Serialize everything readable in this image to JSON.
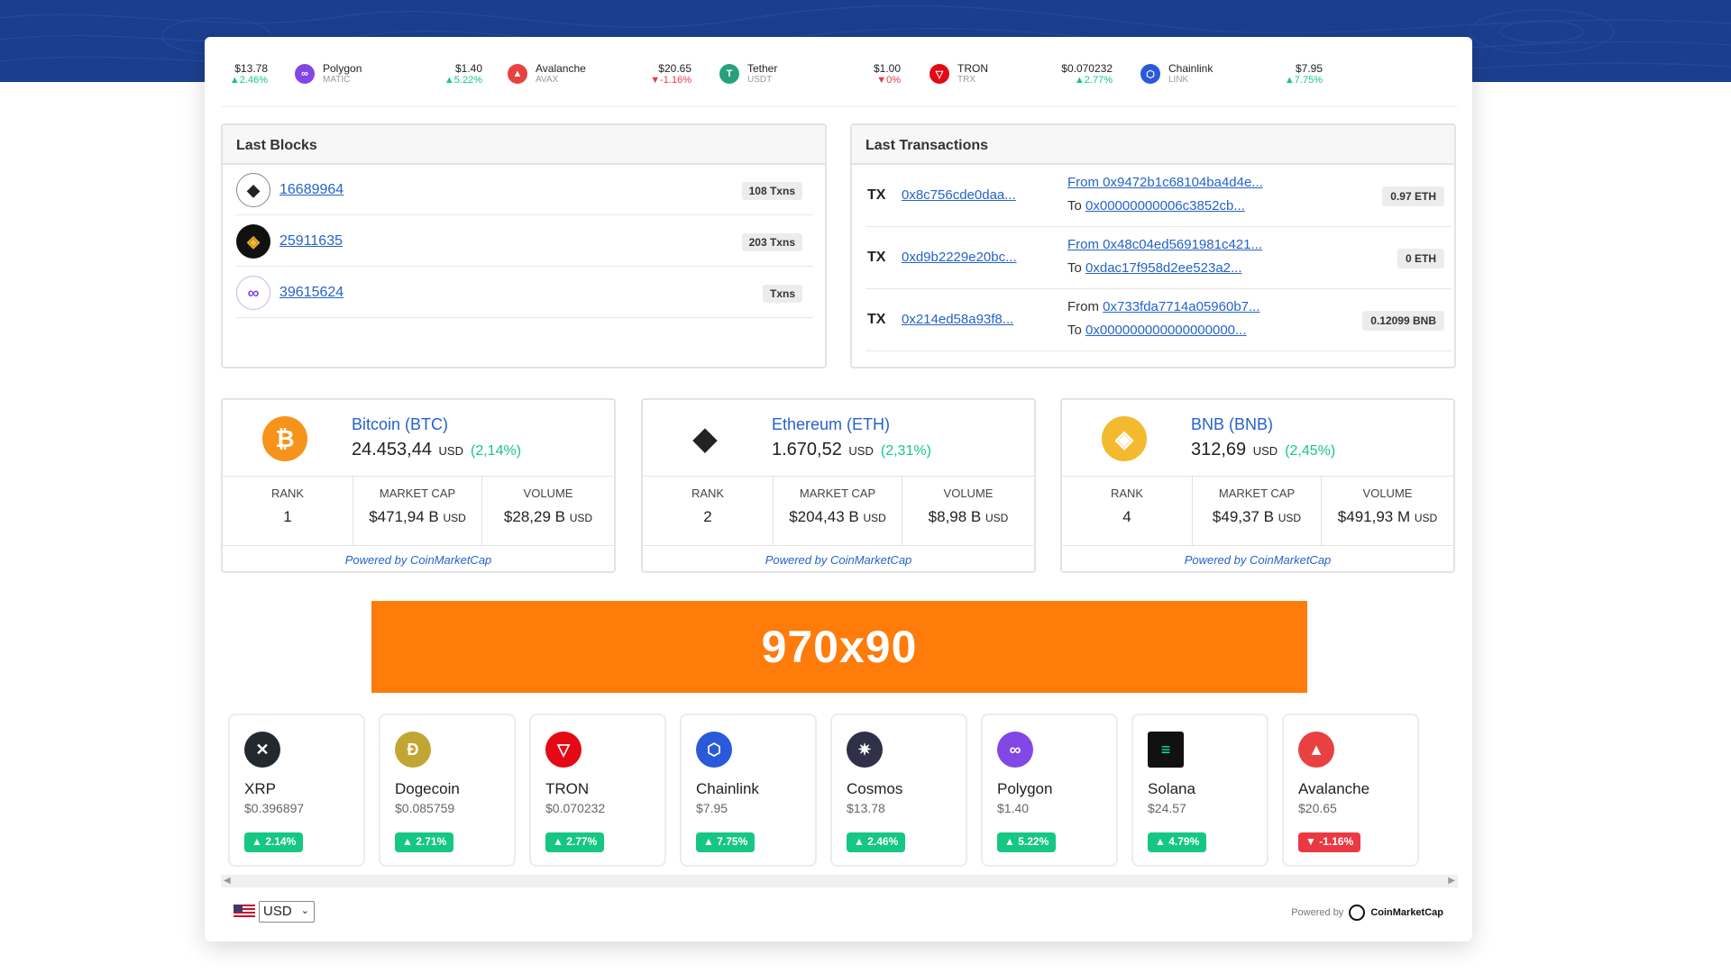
{
  "ticker": [
    {
      "price": "$13.78",
      "change": "2.46%",
      "dir": "up"
    },
    {
      "name": "Polygon",
      "symbol": "MATIC",
      "price": "$1.40",
      "change": "5.22%",
      "dir": "up",
      "color": "#8247e5",
      "glyph": "∞"
    },
    {
      "name": "Avalanche",
      "symbol": "AVAX",
      "price": "$20.65",
      "change": "-1.16%",
      "dir": "down",
      "color": "#e84142",
      "glyph": "▲"
    },
    {
      "name": "Tether",
      "symbol": "USDT",
      "price": "$1.00",
      "change": "0%",
      "dir": "down",
      "color": "#26a17b",
      "glyph": "T"
    },
    {
      "name": "TRON",
      "symbol": "TRX",
      "price": "$0.070232",
      "change": "2.77%",
      "dir": "up",
      "color": "#e50915",
      "glyph": "▽"
    },
    {
      "name": "Chainlink",
      "symbol": "LINK",
      "price": "$7.95",
      "change": "7.75%",
      "dir": "up",
      "color": "#2a5ada",
      "glyph": "⬡"
    }
  ],
  "last_blocks": {
    "title": "Last Blocks",
    "rows": [
      {
        "number": "16689964",
        "txns": "108 Txns",
        "chain": "ethereum"
      },
      {
        "number": "25911635",
        "txns": "203 Txns",
        "chain": "bnb"
      },
      {
        "number": "39615624",
        "txns": "Txns",
        "chain": "polygon"
      }
    ]
  },
  "last_transactions": {
    "title": "Last Transactions",
    "rows": [
      {
        "label": "TX",
        "hash": "0x8c756cde0daa...",
        "from_prefix": "From ",
        "from": "0x9472b1c68104ba4d4e...",
        "from_linked": true,
        "to_prefix": "To ",
        "to": "0x00000000006c3852cb...",
        "amount": "0.97 ETH"
      },
      {
        "label": "TX",
        "hash": "0xd9b2229e20bc...",
        "from_prefix": "From ",
        "from": "0x48c04ed5691981c421...",
        "from_linked": true,
        "to_prefix": "To ",
        "to": "0xdac17f958d2ee523a2...",
        "amount": "0 ETH"
      },
      {
        "label": "TX",
        "hash": "0x214ed58a93f8...",
        "from_prefix": "From ",
        "from": "0x733fda7714a05960b7...",
        "from_linked": false,
        "to_prefix": "To ",
        "to": "0x000000000000000000...",
        "amount": "0.12099 BNB"
      }
    ]
  },
  "price_cards": [
    {
      "title": "Bitcoin (BTC)",
      "price": "24.453,44",
      "currency": "USD",
      "change": "(2,14%)",
      "rank_label": "RANK",
      "rank": "1",
      "mcap_label": "MARKET CAP",
      "mcap": "$471,94 B",
      "vol_label": "VOLUME",
      "volume": "$28,29 B",
      "powered": "Powered by CoinMarketCap",
      "color": "#f7931a",
      "glyph": "₿"
    },
    {
      "title": "Ethereum (ETH)",
      "price": "1.670,52",
      "currency": "USD",
      "change": "(2,31%)",
      "rank_label": "RANK",
      "rank": "2",
      "mcap_label": "MARKET CAP",
      "mcap": "$204,43 B",
      "vol_label": "VOLUME",
      "volume": "$8,98 B",
      "powered": "Powered by CoinMarketCap",
      "color": "#ffffff",
      "glyph": "◆"
    },
    {
      "title": "BNB (BNB)",
      "price": "312,69",
      "currency": "USD",
      "change": "(2,45%)",
      "rank_label": "RANK",
      "rank": "4",
      "mcap_label": "MARKET CAP",
      "mcap": "$49,37 B",
      "vol_label": "VOLUME",
      "volume": "$491,93 M",
      "powered": "Powered by CoinMarketCap",
      "color": "#f3ba2f",
      "glyph": "◈"
    }
  ],
  "ad": {
    "label": "970x90"
  },
  "coin_tiles": [
    {
      "name": "XRP",
      "price": "$0.396897",
      "change": "2.14%",
      "dir": "up",
      "color": "#23292f",
      "glyph": "✕"
    },
    {
      "name": "Dogecoin",
      "price": "$0.085759",
      "change": "2.71%",
      "dir": "up",
      "color": "#c2a633",
      "glyph": "Ð"
    },
    {
      "name": "TRON",
      "price": "$0.070232",
      "change": "2.77%",
      "dir": "up",
      "color": "#e50915",
      "glyph": "▽"
    },
    {
      "name": "Chainlink",
      "price": "$7.95",
      "change": "7.75%",
      "dir": "up",
      "color": "#2a5ada",
      "glyph": "⬡"
    },
    {
      "name": "Cosmos",
      "price": "$13.78",
      "change": "2.46%",
      "dir": "up",
      "color": "#2e3148",
      "glyph": "✷"
    },
    {
      "name": "Polygon",
      "price": "$1.40",
      "change": "5.22%",
      "dir": "up",
      "color": "#8247e5",
      "glyph": "∞"
    },
    {
      "name": "Solana",
      "price": "$24.57",
      "change": "4.79%",
      "dir": "up",
      "color": "#111111",
      "glyph": "≡"
    },
    {
      "name": "Avalanche",
      "price": "$20.65",
      "change": "-1.16%",
      "dir": "down",
      "color": "#e84142",
      "glyph": "▲"
    }
  ],
  "footer": {
    "currency": "USD",
    "powered_prefix": "Powered by",
    "powered_brand": "CoinMarketCap"
  }
}
